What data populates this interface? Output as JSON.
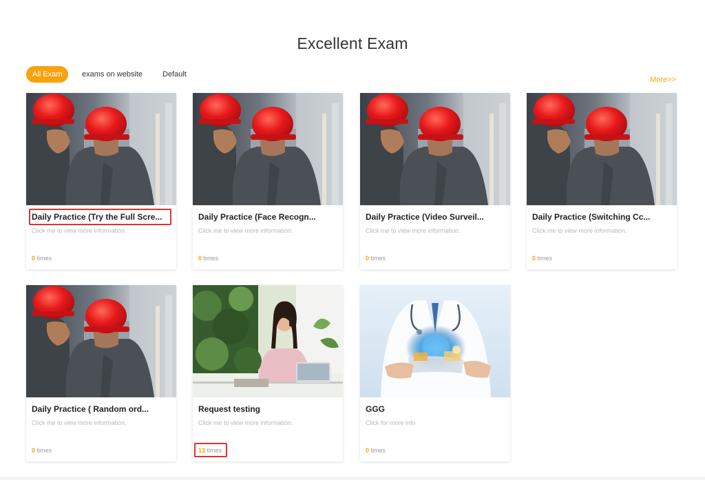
{
  "page_title": "Excellent Exam",
  "tabs": [
    {
      "label": "All Exam",
      "active": true
    },
    {
      "label": "exams on website",
      "active": false
    },
    {
      "label": "Default",
      "active": false
    }
  ],
  "more_link": "More>>",
  "cards": [
    {
      "title": "Daily Practice (Try the Full Scre...",
      "desc": "Click me to view more information.",
      "count": "0",
      "count_suffix": " times",
      "image": "workers-red-helmets"
    },
    {
      "title": "Daily Practice (Face Recogn...",
      "desc": "Click me to view more information.",
      "count": "0",
      "count_suffix": " times",
      "image": "workers-red-helmets"
    },
    {
      "title": "Daily Practice (Video Surveil...",
      "desc": "Click me to view more information.",
      "count": "0",
      "count_suffix": " times",
      "image": "workers-red-helmets"
    },
    {
      "title": "Daily Practice (Switching Cc...",
      "desc": "Click me to view more information.",
      "count": "0",
      "count_suffix": " times",
      "image": "workers-red-helmets"
    },
    {
      "title": "Daily Practice ( Random ord...",
      "desc": "Click me to view more information.",
      "count": "0",
      "count_suffix": " times",
      "image": "workers-red-helmets"
    },
    {
      "title": "Request testing",
      "desc": "Click me to view more information.",
      "count": "13",
      "count_suffix": " times",
      "image": "woman-on-phone-laptop"
    },
    {
      "title": "GGG",
      "desc": "Click for more info",
      "count": "0",
      "count_suffix": " times",
      "image": "doctor-tablet-brain"
    }
  ],
  "colors": {
    "accent": "#f8a20e",
    "highlight": "#e03030"
  }
}
